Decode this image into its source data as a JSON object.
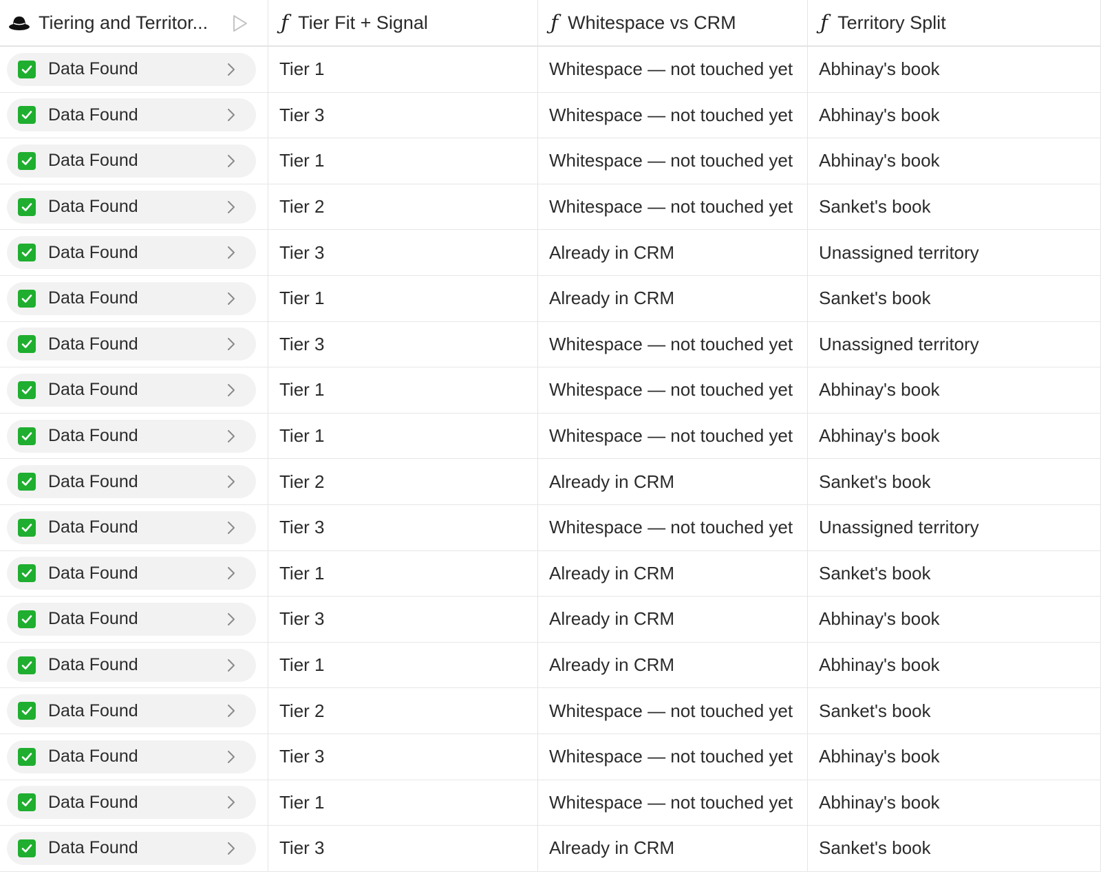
{
  "columns": {
    "c1": {
      "title": "Tiering and Territor...",
      "icon": "hat-icon"
    },
    "c2": {
      "title": "Tier Fit + Signal",
      "icon": "function-icon"
    },
    "c3": {
      "title": "Whitespace vs CRM",
      "icon": "function-icon"
    },
    "c4": {
      "title": "Territory Split",
      "icon": "function-icon"
    }
  },
  "rows": [
    {
      "status": "Data Found",
      "tier": "Tier 1",
      "whitespace": "Whitespace — not touched yet",
      "territory": "Abhinay's book"
    },
    {
      "status": "Data Found",
      "tier": "Tier 3",
      "whitespace": "Whitespace — not touched yet",
      "territory": "Abhinay's book"
    },
    {
      "status": "Data Found",
      "tier": "Tier 1",
      "whitespace": "Whitespace — not touched yet",
      "territory": "Abhinay's book"
    },
    {
      "status": "Data Found",
      "tier": "Tier 2",
      "whitespace": "Whitespace — not touched yet",
      "territory": "Sanket's book"
    },
    {
      "status": "Data Found",
      "tier": "Tier 3",
      "whitespace": "Already in CRM",
      "territory": "Unassigned territory"
    },
    {
      "status": "Data Found",
      "tier": "Tier 1",
      "whitespace": "Already in CRM",
      "territory": "Sanket's book"
    },
    {
      "status": "Data Found",
      "tier": "Tier 3",
      "whitespace": "Whitespace — not touched yet",
      "territory": "Unassigned territory"
    },
    {
      "status": "Data Found",
      "tier": "Tier 1",
      "whitespace": "Whitespace — not touched yet",
      "territory": "Abhinay's book"
    },
    {
      "status": "Data Found",
      "tier": "Tier 1",
      "whitespace": "Whitespace — not touched yet",
      "territory": "Abhinay's book"
    },
    {
      "status": "Data Found",
      "tier": "Tier 2",
      "whitespace": "Already in CRM",
      "territory": "Sanket's book"
    },
    {
      "status": "Data Found",
      "tier": "Tier 3",
      "whitespace": "Whitespace — not touched yet",
      "territory": "Unassigned territory"
    },
    {
      "status": "Data Found",
      "tier": "Tier 1",
      "whitespace": "Already in CRM",
      "territory": "Sanket's book"
    },
    {
      "status": "Data Found",
      "tier": "Tier 3",
      "whitespace": "Already in CRM",
      "territory": "Abhinay's book"
    },
    {
      "status": "Data Found",
      "tier": "Tier 1",
      "whitespace": "Already in CRM",
      "territory": "Abhinay's book"
    },
    {
      "status": "Data Found",
      "tier": "Tier 2",
      "whitespace": "Whitespace — not touched yet",
      "territory": "Sanket's book"
    },
    {
      "status": "Data Found",
      "tier": "Tier 3",
      "whitespace": "Whitespace — not touched yet",
      "territory": "Abhinay's book"
    },
    {
      "status": "Data Found",
      "tier": "Tier 1",
      "whitespace": "Whitespace — not touched yet",
      "territory": "Abhinay's book"
    },
    {
      "status": "Data Found",
      "tier": "Tier 3",
      "whitespace": "Already in CRM",
      "territory": "Sanket's book"
    }
  ],
  "colors": {
    "check": "#1fae2f",
    "pill_bg": "#f2f2f2",
    "grid_line": "#e4e4e4"
  }
}
